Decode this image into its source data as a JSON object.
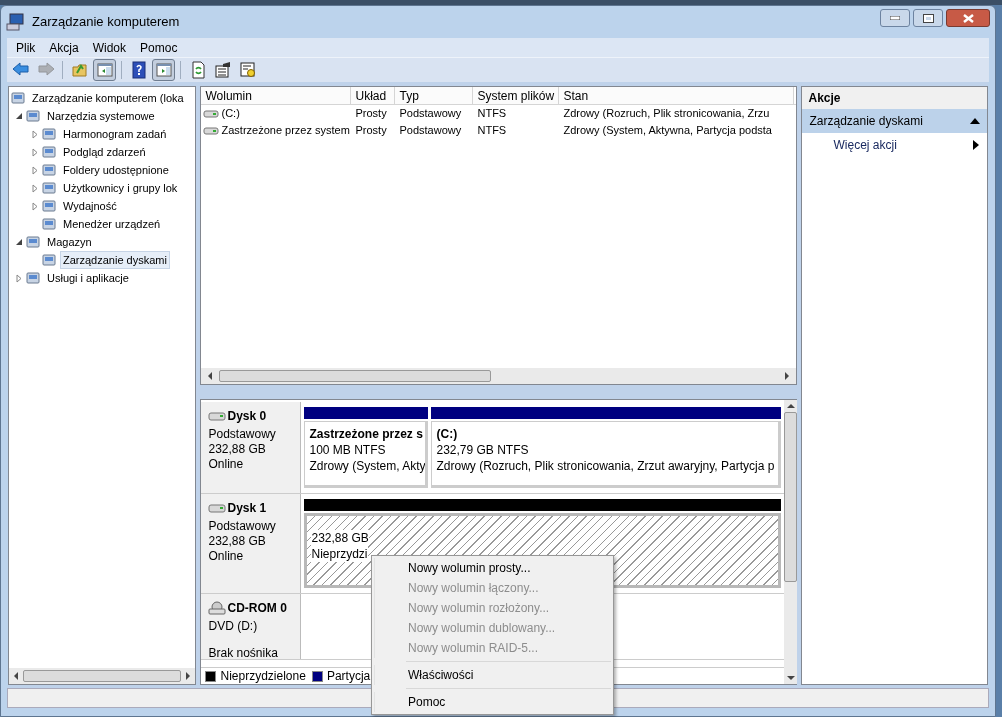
{
  "window": {
    "title": "Zarządzanie komputerem"
  },
  "menu": [
    "Plik",
    "Akcja",
    "Widok",
    "Pomoc"
  ],
  "toolbar": [
    {
      "kind": "back",
      "disabled": false,
      "pressed": false
    },
    {
      "kind": "forward",
      "disabled": true,
      "pressed": false
    },
    {
      "kind": "up",
      "disabled": false,
      "pressed": false
    },
    {
      "kind": "tree",
      "disabled": false,
      "pressed": true
    },
    {
      "kind": "help",
      "disabled": false,
      "pressed": false
    },
    {
      "kind": "pane",
      "disabled": false,
      "pressed": true
    },
    {
      "kind": "refresh",
      "disabled": false,
      "pressed": false
    },
    {
      "kind": "properties",
      "disabled": false,
      "pressed": false
    },
    {
      "kind": "settings",
      "disabled": false,
      "pressed": false
    }
  ],
  "tree": [
    {
      "label": "Zarządzanie komputerem (loka",
      "selected": false,
      "children": [
        {
          "label": "Narzędzia systemowe",
          "selected": false,
          "expanded": true,
          "children": [
            {
              "label": "Harmonogram zadań",
              "selected": false,
              "expanded": false
            },
            {
              "label": "Podgląd zdarzeń",
              "selected": false,
              "expanded": false
            },
            {
              "label": "Foldery udostępnione",
              "selected": false,
              "expanded": false
            },
            {
              "label": "Użytkownicy i grupy lok",
              "selected": false,
              "expanded": false
            },
            {
              "label": "Wydajność",
              "selected": false,
              "expanded": false
            },
            {
              "label": "Menedżer urządzeń",
              "selected": false
            }
          ]
        },
        {
          "label": "Magazyn",
          "selected": false,
          "expanded": true,
          "children": [
            {
              "label": "Zarządzanie dyskami",
              "selected": true
            }
          ]
        },
        {
          "label": "Usługi i aplikacje",
          "selected": false,
          "expanded": false
        }
      ]
    }
  ],
  "volumes": {
    "columns": [
      "Wolumin",
      "Układ",
      "Typ",
      "System plików",
      "Stan"
    ],
    "rows": [
      [
        "(C:)",
        "Prosty",
        "Podstawowy",
        "NTFS",
        "Zdrowy (Rozruch, Plik stronicowania, Zrzu"
      ],
      [
        "Zastrzeżone przez system",
        "Prosty",
        "Podstawowy",
        "NTFS",
        "Zdrowy (System, Aktywna, Partycja podsta"
      ]
    ]
  },
  "disks": [
    {
      "name": "Dysk 0",
      "kind": "disk",
      "lines": [
        "Podstawowy",
        "232,88 GB",
        "Online"
      ],
      "partitions": [
        {
          "kind": "primary",
          "color": "#000080",
          "title": "Zastrzeżone przez s",
          "size": "100 MB NTFS",
          "status": "Zdrowy (System, Akty"
        },
        {
          "kind": "primary",
          "color": "#000080",
          "title": "(C:)",
          "size": "232,79 GB NTFS",
          "status": "Zdrowy (Rozruch, Plik stronicowania, Zrzut awaryjny, Partycja p"
        }
      ]
    },
    {
      "name": "Dysk 1",
      "kind": "disk",
      "lines": [
        "Podstawowy",
        "232,88 GB",
        "Online"
      ],
      "partitions": [
        {
          "kind": "unallocated",
          "color": "#000000",
          "size": "232,88 GB",
          "status": "Nieprzydzi"
        }
      ]
    },
    {
      "name": "CD-ROM 0",
      "kind": "cdrom",
      "lines": [
        "DVD (D:)",
        "Brak nośnika"
      ]
    }
  ],
  "legend": [
    {
      "label": "Nieprzydzielone",
      "color": "#000000"
    },
    {
      "label": "Partycja",
      "color": "#000080"
    }
  ],
  "actions": {
    "title": "Akcje",
    "section": "Zarządzanie dyskami",
    "items": [
      "Więcej akcji"
    ]
  },
  "context_menu": [
    {
      "kind": "item",
      "label": "Nowy wolumin prosty...",
      "disabled": false
    },
    {
      "kind": "item",
      "label": "Nowy wolumin łączony...",
      "disabled": true
    },
    {
      "kind": "item",
      "label": "Nowy wolumin rozłożony...",
      "disabled": true
    },
    {
      "kind": "item",
      "label": "Nowy wolumin dublowany...",
      "disabled": true
    },
    {
      "kind": "item",
      "label": "Nowy wolumin RAID-5...",
      "disabled": true
    },
    {
      "kind": "separator"
    },
    {
      "kind": "item",
      "label": "Właściwości",
      "disabled": false
    },
    {
      "kind": "separator"
    },
    {
      "kind": "item",
      "label": "Pomoc",
      "disabled": false
    }
  ]
}
